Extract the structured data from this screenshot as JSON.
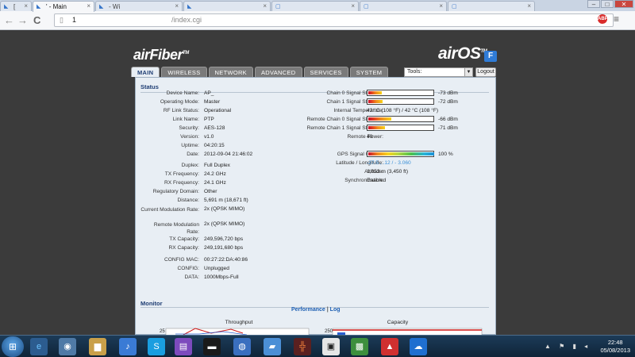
{
  "browser": {
    "tabs": [
      {
        "label": "[",
        "active": false
      },
      {
        "label": "' - Main",
        "active": true
      },
      {
        "label": "- Wi",
        "active": false
      },
      {
        "label": "",
        "active": false
      },
      {
        "label": "",
        "active": false
      },
      {
        "label": "",
        "active": false
      },
      {
        "label": "",
        "active": false
      }
    ],
    "address": {
      "prefix": "1",
      "path": "/index.cgi"
    },
    "back": "←",
    "forward": "→",
    "reload": "C",
    "badge": "ABP",
    "wrench": "≡",
    "window_buttons": {
      "min": "–",
      "max": "□",
      "close": "✕"
    }
  },
  "header": {
    "brand_left": "airFiber",
    "brand_left_tm": "TM",
    "brand_right": "airOS",
    "brand_right_tm": "TM",
    "badge": "F",
    "tools_label": "Tools:",
    "logout_label": "Logout"
  },
  "nav_tabs": [
    {
      "label": "MAIN",
      "active": true
    },
    {
      "label": "WIRELESS",
      "active": false
    },
    {
      "label": "NETWORK",
      "active": false
    },
    {
      "label": "ADVANCED",
      "active": false
    },
    {
      "label": "SERVICES",
      "active": false
    },
    {
      "label": "SYSTEM",
      "active": false
    }
  ],
  "status": {
    "heading": "Status",
    "left": [
      {
        "label": "Device Name:",
        "value": "AP_"
      },
      {
        "label": "Operating Mode:",
        "value": "Master"
      },
      {
        "label": "RF Link Status:",
        "value": "Operational"
      },
      {
        "label": "Link Name:",
        "value": "PTP"
      },
      {
        "label": "Security:",
        "value": "AES-128"
      },
      {
        "label": "Version:",
        "value": "v1.0"
      },
      {
        "label": "Uptime:",
        "value": "04:20:15"
      },
      {
        "label": "Date:",
        "value": "2012-09-04 21:46:02"
      },
      {
        "label": "Duplex:",
        "value": "Full Duplex"
      },
      {
        "label": "TX Frequency:",
        "value": "24.2 GHz"
      },
      {
        "label": "RX Frequency:",
        "value": "24.1 GHz"
      },
      {
        "label": "Regulatory Domain:",
        "value": "Other"
      },
      {
        "label": "Distance:",
        "value": "5,691 m (18,671 ft)"
      },
      {
        "label": "Current Modulation Rate:",
        "value": "2x (QPSK MIMO)"
      },
      {
        "label": "Remote Modulation Rate:",
        "value": "2x (QPSK MIMO)"
      },
      {
        "label": "TX Capacity:",
        "value": "249,596,720 bps"
      },
      {
        "label": "RX Capacity:",
        "value": "249,191,680 bps"
      },
      {
        "label": "CONFIG MAC:",
        "value": "00:27:22:DA:40:86"
      },
      {
        "label": "CONFIG:",
        "value": "Unplugged"
      },
      {
        "label": "DATA:",
        "value": "1000Mbps-Full"
      }
    ],
    "right_signals": [
      {
        "label": "Chain 0 Signal Strength:",
        "value": "-73 dBm",
        "level": 0.2
      },
      {
        "label": "Chain 1 Signal Strength:",
        "value": "-72 dBm",
        "level": 0.22
      },
      {
        "label": "Internal Temperature:",
        "value": "42 °C (108 °F) / 42 °C (108 °F)"
      },
      {
        "label": "Remote Chain 0 Signal Strength:",
        "value": "-66 dBm",
        "level": 0.35
      },
      {
        "label": "Remote Chain 1 Signal Strength:",
        "value": "-71 dBm",
        "level": 0.25
      },
      {
        "label": "Remote Power:",
        "value": "40"
      }
    ],
    "right_gps": [
      {
        "label": "GPS Signal Quality:",
        "value": "100 %",
        "level": 1.0
      },
      {
        "label": "Latitude / Longitude:",
        "value": "-27.5 ,  .12 / -  3.060"
      },
      {
        "label": "Altitude:",
        "value": "1,052 m (3,450 ft)"
      },
      {
        "label": "Synchronization:",
        "value": "Enabled"
      }
    ]
  },
  "monitor": {
    "heading": "Monitor",
    "link_performance": "Performance",
    "link_sep": "|",
    "link_log": "Log",
    "chart_left_title": "Throughput",
    "chart_left_tick": "25",
    "chart_right_title": "Capacity",
    "chart_right_tick": "250"
  },
  "taskbar": {
    "start": "⊞",
    "time": "22:48",
    "date": "05/08/2013",
    "tray": "▲ ⚑ ▮ ◂"
  }
}
